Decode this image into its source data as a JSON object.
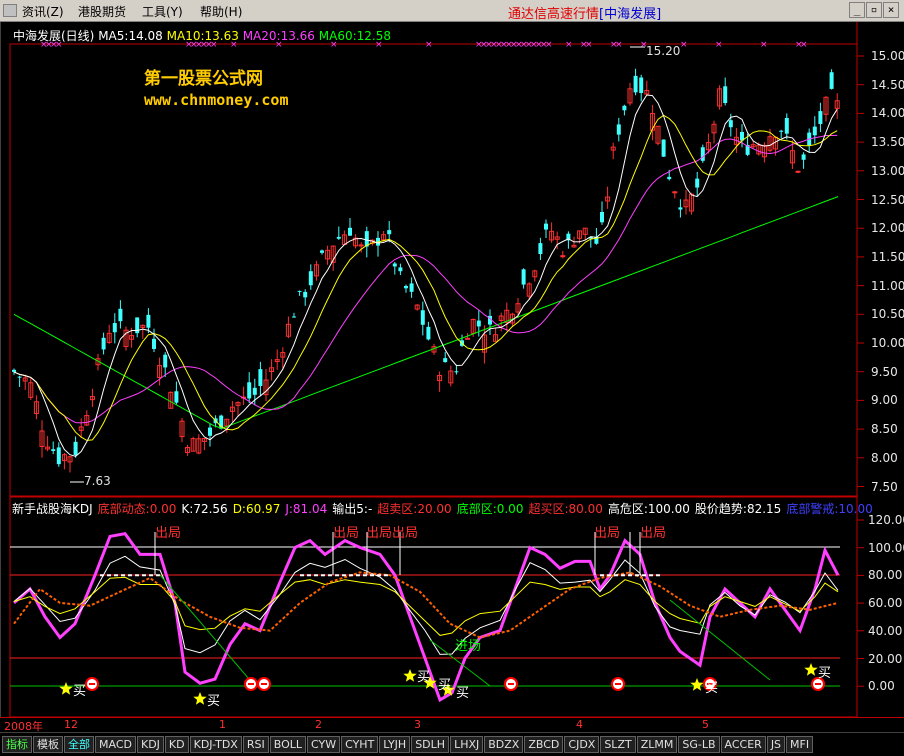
{
  "menu": {
    "items": [
      "资讯(Z)",
      "港股期货",
      "工具(Y)",
      "帮助(H)"
    ],
    "title_main": "通达信高速行情",
    "title_bracket": "[中海发展]"
  },
  "main": {
    "stock_label": "中海发展(日线)",
    "ma5": "MA5:14.08",
    "ma10": "MA10:13.63",
    "ma20": "MA20:13.66",
    "ma60": "MA60:12.58",
    "watermark_cn": "第一股票公式网",
    "watermark_url": "www.chnmoney.com",
    "high_label": "15.20",
    "low_label": "7.63",
    "yaxis": [
      "15.00",
      "14.50",
      "14.00",
      "13.50",
      "13.00",
      "12.50",
      "12.00",
      "11.50",
      "11.00",
      "10.50",
      "10.00",
      "9.50",
      "9.00",
      "8.50",
      "8.00",
      "7.50"
    ],
    "colors": {
      "up": "#ff3030",
      "down": "#40ffff",
      "ma5": "#ffffff",
      "ma10": "#ffff00",
      "ma20": "#ff40ff",
      "ma60": "#00ff00"
    }
  },
  "kdj": {
    "name": "新手战股海KDJ",
    "f1": "底部动态:0.00",
    "f2": "K:72.56",
    "f3": "D:60.97",
    "f4": "J:81.04",
    "f5": "输出5:-",
    "f6": "超卖区:20.00",
    "f7": "底部区:0.00",
    "f8": "超买区:80.00",
    "f9": "高危区:100.00",
    "f10": "股价趋势:82.15",
    "f11": "底部警戒:10.00",
    "yaxis": [
      "120.00",
      "100.00",
      "80.00",
      "60.00",
      "40.00",
      "20.00",
      "0.00"
    ],
    "signals": {
      "chuju": [
        "出局",
        "出局",
        "出局出局",
        "出局",
        "出局"
      ],
      "mai": [
        "买",
        "买",
        "买",
        "买",
        "买",
        "买",
        "买",
        "买"
      ],
      "jinchang": "进场"
    }
  },
  "timeline": {
    "year": "2008年",
    "months": [
      "12",
      "1",
      "2",
      "3",
      "4",
      "5"
    ]
  },
  "tabs": [
    "指标",
    "模板",
    "全部",
    "MACD",
    "KDJ",
    "KD",
    "KDJ-TDX",
    "RSI",
    "BOLL",
    "CYW",
    "CYHT",
    "LYJH",
    "SDLH",
    "LHXJ",
    "BDZX",
    "ZBCD",
    "CJDX",
    "SLZT",
    "ZLMM",
    "SG-LB",
    "ACCER",
    "JS",
    "MFI"
  ]
}
